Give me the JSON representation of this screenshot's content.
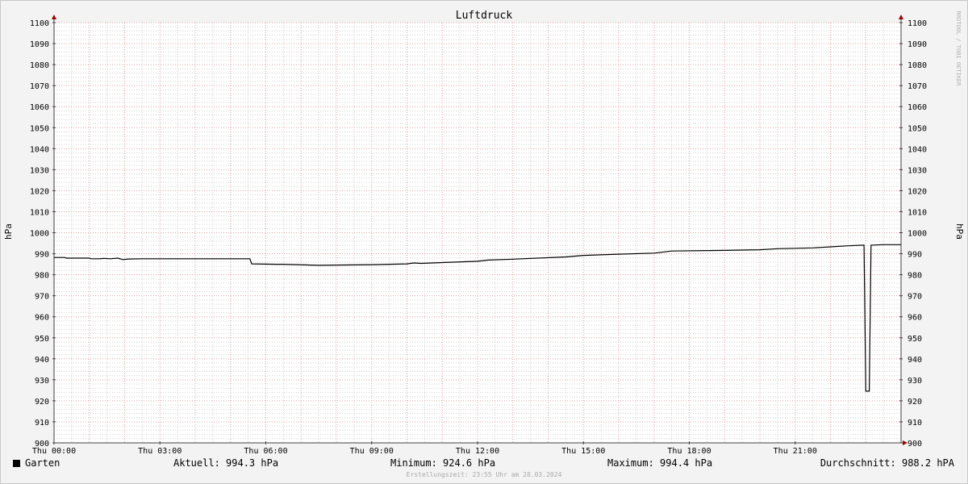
{
  "chart_data": {
    "type": "line",
    "title": "Luftdruck",
    "ylabel": "hPa",
    "ylim": [
      900,
      1100
    ],
    "y_ticks": [
      900,
      910,
      920,
      930,
      940,
      950,
      960,
      970,
      980,
      990,
      1000,
      1010,
      1020,
      1030,
      1040,
      1050,
      1060,
      1070,
      1080,
      1090,
      1100
    ],
    "x_range_hours": [
      0,
      24
    ],
    "x_ticks": [
      {
        "hour": 0,
        "label": "Thu 00:00"
      },
      {
        "hour": 3,
        "label": "Thu 03:00"
      },
      {
        "hour": 6,
        "label": "Thu 06:00"
      },
      {
        "hour": 9,
        "label": "Thu 09:00"
      },
      {
        "hour": 12,
        "label": "Thu 12:00"
      },
      {
        "hour": 15,
        "label": "Thu 15:00"
      },
      {
        "hour": 18,
        "label": "Thu 18:00"
      },
      {
        "hour": 21,
        "label": "Thu 21:00"
      }
    ],
    "grid": true,
    "series": [
      {
        "name": "Garten",
        "color": "#000000",
        "points": [
          [
            0,
            988.2
          ],
          [
            0.3,
            988.2
          ],
          [
            0.35,
            987.9
          ],
          [
            1.0,
            987.9
          ],
          [
            1.05,
            987.6
          ],
          [
            1.3,
            987.6
          ],
          [
            1.4,
            987.8
          ],
          [
            1.6,
            987.6
          ],
          [
            1.8,
            987.9
          ],
          [
            1.95,
            987.2
          ],
          [
            2.1,
            987.5
          ],
          [
            2.5,
            987.6
          ],
          [
            5.55,
            987.6
          ],
          [
            5.6,
            985.2
          ],
          [
            6.3,
            985.0
          ],
          [
            6.5,
            985.0
          ],
          [
            7.1,
            984.7
          ],
          [
            7.5,
            984.5
          ],
          [
            9.0,
            984.8
          ],
          [
            10.0,
            985.2
          ],
          [
            10.2,
            985.6
          ],
          [
            10.4,
            985.4
          ],
          [
            11.0,
            985.8
          ],
          [
            12.0,
            986.4
          ],
          [
            12.3,
            987.0
          ],
          [
            13.0,
            987.4
          ],
          [
            14.5,
            988.5
          ],
          [
            15.0,
            989.2
          ],
          [
            16.0,
            989.8
          ],
          [
            17.0,
            990.3
          ],
          [
            17.5,
            991.3
          ],
          [
            19.0,
            991.6
          ],
          [
            20.0,
            991.9
          ],
          [
            20.5,
            992.4
          ],
          [
            21.5,
            992.8
          ],
          [
            22.0,
            993.3
          ],
          [
            22.5,
            993.8
          ],
          [
            22.95,
            994.1
          ],
          [
            23.0,
            924.6
          ],
          [
            23.1,
            924.6
          ],
          [
            23.15,
            994.1
          ],
          [
            23.5,
            994.3
          ],
          [
            24.0,
            994.3
          ]
        ]
      }
    ],
    "legend": {
      "series_name": "Garten",
      "aktuell": "Aktuell: 994.3 hPa",
      "minimum": "Minimum: 924.6 hPa",
      "maximum": "Maximum: 994.4 hPa",
      "durchschnitt": "Durchschnitt: 988.2 hPA"
    },
    "watermark": "RRDTOOL / TOBI OETIKER",
    "footer": "Erstellungszeit: 23:55 Uhr am 28.03.2024",
    "colors": {
      "grid_minor": "#d0d0d0",
      "grid_major": "#e0a0a0",
      "axis": "#404040",
      "arrow": "#a00000"
    }
  }
}
